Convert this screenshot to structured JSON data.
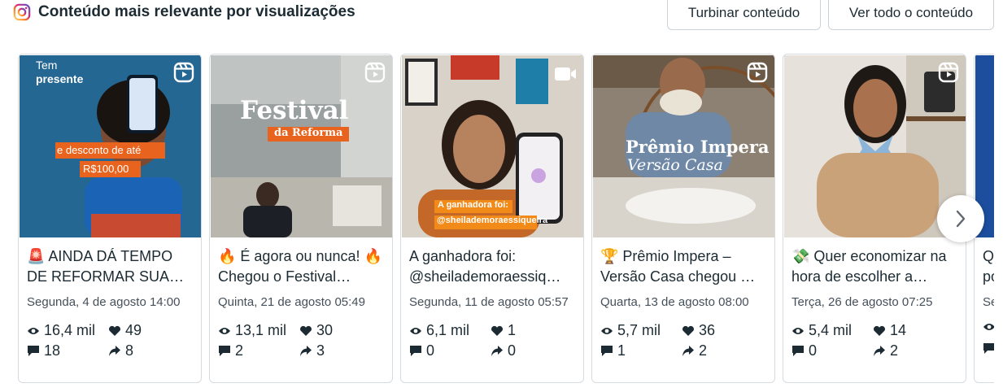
{
  "header": {
    "title": "Conteúdo mais relevante por visualizações",
    "boost_label": "Turbinar conteúdo",
    "view_all_label": "Ver todo o conteúdo"
  },
  "posts": [
    {
      "type_icon": "reel-icon",
      "title": "🚨 AINDA DÁ TEMPO DE REFORMAR SUA…",
      "date": "Segunda, 4 de agosto 14:00",
      "views": "16,4 mil",
      "likes": "49",
      "comments": "18",
      "shares": "8",
      "overlay_top": "Tem",
      "overlay_top2": "presente",
      "overlay_mid": "e desconto de até",
      "overlay_price": "R$100,00"
    },
    {
      "type_icon": "reel-icon",
      "title": "🔥 É agora ou nunca! 🔥 Chegou o Festival…",
      "date": "Quinta, 21 de agosto 05:49",
      "views": "13,1 mil",
      "likes": "30",
      "comments": "2",
      "shares": "3",
      "overlay_big": "Festival",
      "overlay_small": "da Reforma"
    },
    {
      "type_icon": "video-icon",
      "title": "A ganhadora foi: @sheilademoraessiq…",
      "date": "Segunda, 11 de agosto 05:57",
      "views": "6,1 mil",
      "likes": "1",
      "comments": "0",
      "shares": "0",
      "overlay_line1": "A ganhadora foi:",
      "overlay_line2": "@sheilademoraessiqueira"
    },
    {
      "type_icon": "reel-icon",
      "title": "🏆 Prêmio Impera – Versão Casa chegou …",
      "date": "Quarta, 13 de agosto 08:00",
      "views": "5,7 mil",
      "likes": "36",
      "comments": "1",
      "shares": "2",
      "overlay_line1": "Prêmio Impera",
      "overlay_line2": "Versão Casa"
    },
    {
      "type_icon": "reel-icon",
      "title": "💸 Quer economizar na hora de escolher a…",
      "date": "Terça, 26 de agosto 07:25",
      "views": "5,4 mil",
      "likes": "14",
      "comments": "0",
      "shares": "2"
    },
    {
      "title": "Q… po…",
      "date": "Se…"
    }
  ],
  "colors": {
    "text": "#1c2b33",
    "muted": "#46505a",
    "border": "#d6dbe0",
    "thumb1_bg": "#2a6f9c",
    "thumb1_tag": "#e8641e",
    "thumb2_tag": "#e8641e",
    "thumb3_tag": "#f28a1a",
    "thumb6_bg": "#1d4e9e"
  }
}
